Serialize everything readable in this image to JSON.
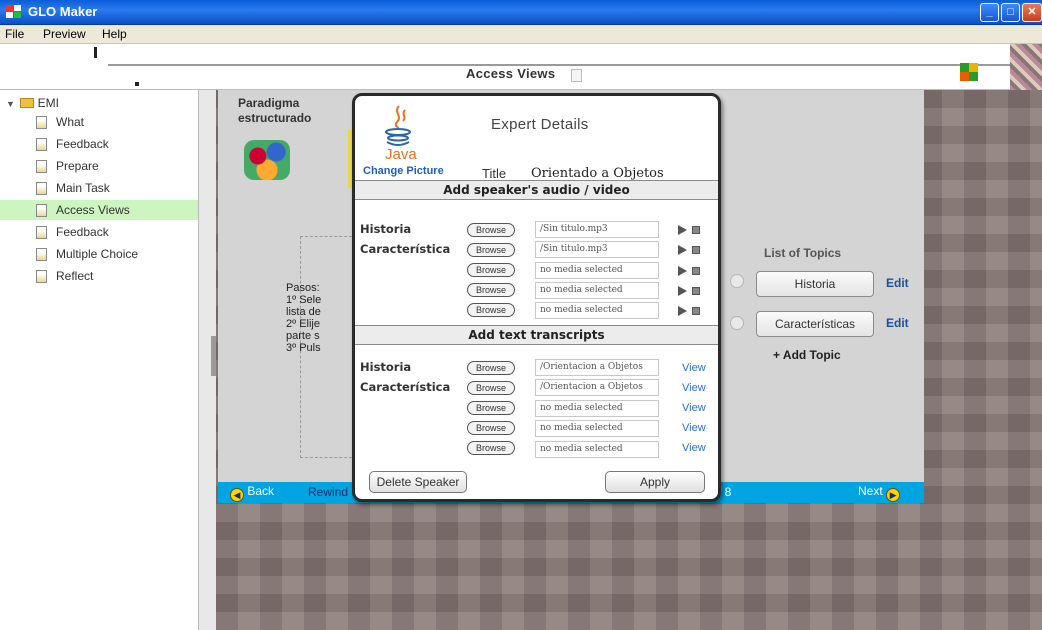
{
  "window": {
    "title": "GLO Maker"
  },
  "menu": {
    "items": [
      "File",
      "Preview",
      "Help"
    ]
  },
  "header": {
    "page_title": "Access Views"
  },
  "sidebar": {
    "root": "EMI",
    "items": [
      {
        "label": "What"
      },
      {
        "label": "Feedback"
      },
      {
        "label": "Prepare"
      },
      {
        "label": "Main Task"
      },
      {
        "label": "Access Views",
        "active": true
      },
      {
        "label": "Feedback"
      },
      {
        "label": "Multiple Choice"
      },
      {
        "label": "Reflect"
      }
    ]
  },
  "slide": {
    "heading_line1": "Paradigma",
    "heading_line2": "estructurado",
    "steps_text": "Pasos:\n1º Sele\nlista de\n2º Elije\nparte s\n3º Puls",
    "topics_title": "List of Topics",
    "topics": [
      {
        "label": "Historia",
        "edit": "Edit"
      },
      {
        "label": "Características",
        "edit": "Edit"
      }
    ],
    "add_topic": "+ Add Topic"
  },
  "navbar": {
    "back": "Back",
    "rewind": "Rewind",
    "page": "f 8",
    "next": "Next"
  },
  "modal": {
    "title": "Expert Details",
    "java_label": "Java",
    "change_picture": "Change Picture",
    "title_label": "Title",
    "title_value": "Orientado a Objetos",
    "audio_section": "Add speaker's audio / video",
    "audio_rows": [
      {
        "label": "Historia",
        "file": "/Sin titulo.mp3"
      },
      {
        "label": "Característica",
        "file": "/Sin titulo.mp3"
      },
      {
        "label": "",
        "file": "no media selected"
      },
      {
        "label": "",
        "file": "no media selected"
      },
      {
        "label": "",
        "file": "no media selected"
      }
    ],
    "text_section": "Add text transcripts",
    "text_rows": [
      {
        "label": "Historia",
        "file": "/Orientacion a Objetos",
        "view": "View"
      },
      {
        "label": "Característica",
        "file": "/Orientacion a Objetos",
        "view": "View"
      },
      {
        "label": "",
        "file": "no media selected",
        "view": "View"
      },
      {
        "label": "",
        "file": "no media selected",
        "view": "View"
      },
      {
        "label": "",
        "file": "no media selected",
        "view": "View"
      }
    ],
    "browse_label": "Browse",
    "delete_button": "Delete Speaker",
    "apply_button": "Apply"
  }
}
